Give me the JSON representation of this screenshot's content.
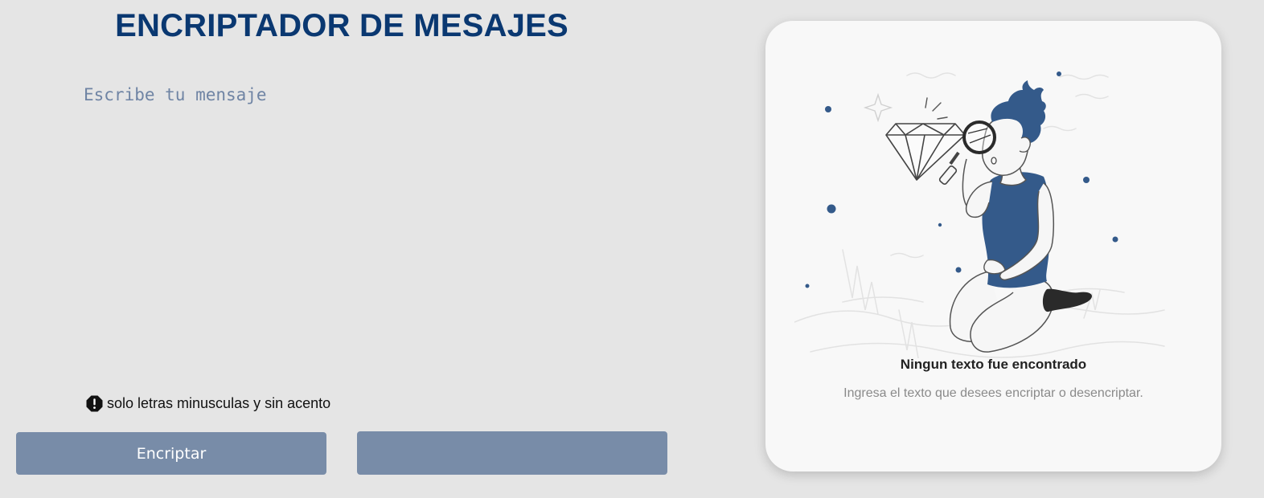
{
  "header": {
    "title": "ENCRIPTADOR DE MESAJES"
  },
  "editor": {
    "placeholder": "Escribe tu mensaje",
    "value": ""
  },
  "hint": {
    "icon": "exclamation-octagon-icon",
    "text": "solo letras minusculas y sin acento"
  },
  "buttons": {
    "encrypt_label": "Encriptar",
    "decrypt_label": ""
  },
  "output": {
    "illustration": "person-with-magnifying-glass-and-diamond",
    "empty_title": "Ningun texto fue encontrado",
    "empty_text": "Ingresa el texto que desees encriptar o desencriptar."
  },
  "colors": {
    "title": "#0a3871",
    "background": "#e5e5e5",
    "button": "#788ca8",
    "card": "#f8f8f8",
    "accent": "#345a8a"
  }
}
